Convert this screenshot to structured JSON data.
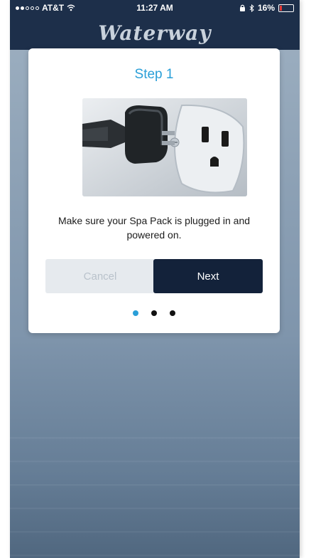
{
  "status_bar": {
    "carrier": "AT&T",
    "wifi_icon": "wifi-icon",
    "time": "11:27 AM",
    "bluetooth_icon": "bluetooth-icon",
    "battery_percent": "16%",
    "battery_level": 0.16
  },
  "header": {
    "logo_text": "Waterway"
  },
  "dialog": {
    "title": "Step 1",
    "image_icon": "power-plug-outlet-illustration",
    "message": "Make sure your Spa Pack is plugged in and powered on.",
    "cancel_label": "Cancel",
    "next_label": "Next",
    "page_indicator": {
      "total": 3,
      "current": 1
    }
  },
  "colors": {
    "accent": "#2a9fd8",
    "header_bg": "#1d2f4a",
    "primary_button": "#13223a",
    "disabled_button_bg": "#e6eaee",
    "battery_low": "#e53935"
  }
}
